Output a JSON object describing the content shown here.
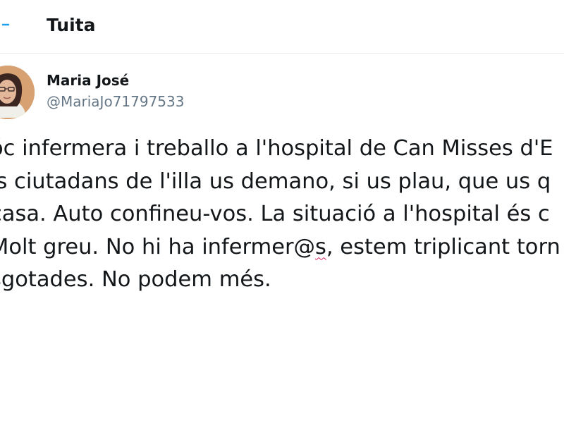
{
  "header": {
    "title": "Tuita",
    "accent_color": "#1da1f2"
  },
  "author": {
    "name": "Maria José",
    "handle": "@MariaJo71797533"
  },
  "tweet": {
    "lines": [
      "óc infermera i treballo a l'hospital de Can Misses d'E",
      "ls ciutadans de l'illa us demano, si us plau, que us q",
      "casa. Auto confineu-vos. La situació a l'hospital és c"
    ],
    "line4_before": "Molt greu. No hi ha infermer@",
    "line4_flagged": "s",
    "line4_after": ", estem triplicant torn",
    "line5": "sgotades. No podem més."
  }
}
